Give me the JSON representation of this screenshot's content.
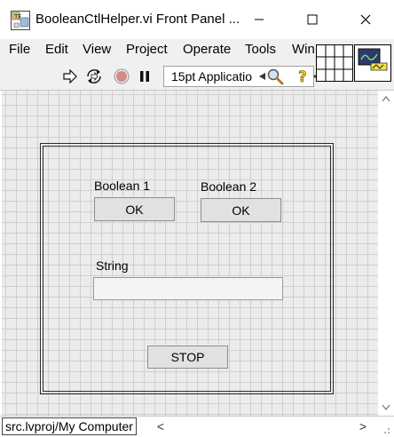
{
  "window": {
    "title": "BooleanCtlHelper.vi Front Panel ...",
    "minimize_glyph": "—",
    "maximize_glyph": "☐",
    "close_glyph": "✕"
  },
  "menu": [
    "File",
    "Edit",
    "View",
    "Project",
    "Operate",
    "Tools",
    "Win"
  ],
  "toolbar": {
    "font": "15pt Applicatio",
    "icons": [
      "run-arrow-icon",
      "run-continuously-icon",
      "abort-icon",
      "pause-icon",
      "font-dropdown-arrow-icon",
      "search-icon",
      "help-icon"
    ]
  },
  "panel": {
    "boolean1": {
      "label": "Boolean 1",
      "text": "OK"
    },
    "boolean2": {
      "label": "Boolean 2",
      "text": "OK"
    },
    "string": {
      "label": "String",
      "value": ""
    },
    "stop": {
      "text": "STOP"
    }
  },
  "status": {
    "project_path": "src.lvproj/My Computer",
    "scroll_left": "<",
    "scroll_right": ">"
  },
  "colors": {
    "grid_bg": "#ececec",
    "grid_line": "#cfcfcf",
    "abort_red": "#d06060",
    "help_yellow": "#f0c000"
  }
}
